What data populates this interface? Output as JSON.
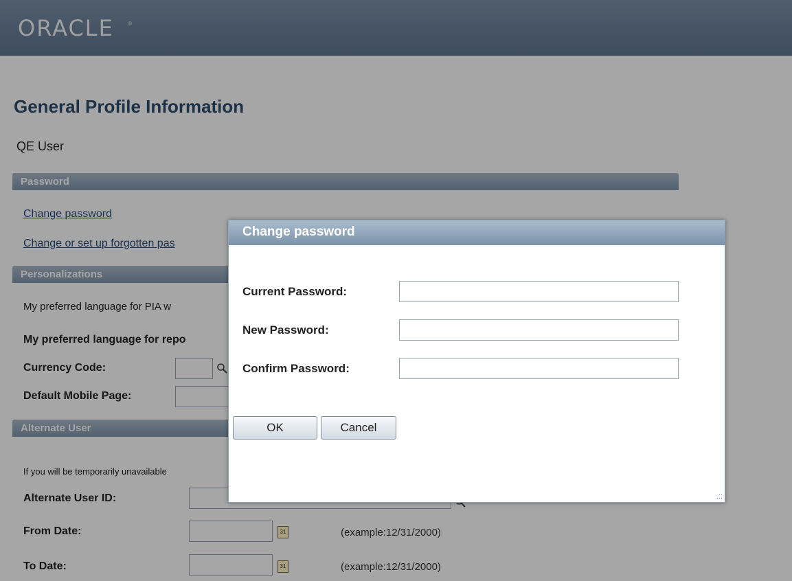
{
  "header": {
    "logo_text": "ORACLE",
    "logo_mark": "®"
  },
  "page": {
    "title": "General Profile Information",
    "user": "QE User"
  },
  "sections": {
    "password": "Password",
    "personalizations": "Personalizations",
    "alternate_user": "Alternate User"
  },
  "password_links": {
    "change_password": "Change password",
    "forgotten": "Change or set up forgotten pas"
  },
  "personalizations": {
    "pia_language": "My preferred language for PIA w",
    "report_language": "My preferred language for repo",
    "currency_code_label": "Currency Code:",
    "default_mobile_page_label": "Default Mobile Page:"
  },
  "alternate_user": {
    "intro": "If you will be temporarily unavailable",
    "user_id_label": "Alternate User ID:",
    "from_date_label": "From Date:",
    "to_date_label": "To Date:",
    "date_example": "(example:12/31/2000)",
    "calendar_glyph": "31"
  },
  "dialog": {
    "title": "Change password",
    "current_label": "Current Password:",
    "new_label": "New Password:",
    "confirm_label": "Confirm Password:",
    "current_value": "",
    "new_value": "",
    "confirm_value": "",
    "ok_label": "OK",
    "cancel_label": "Cancel",
    "resize_glyph": ".::"
  },
  "colors": {
    "header_bar": "#607690",
    "page_title": "#2d4d6d",
    "section_bar": "#7f95ac",
    "link": "#2b4c7a"
  }
}
